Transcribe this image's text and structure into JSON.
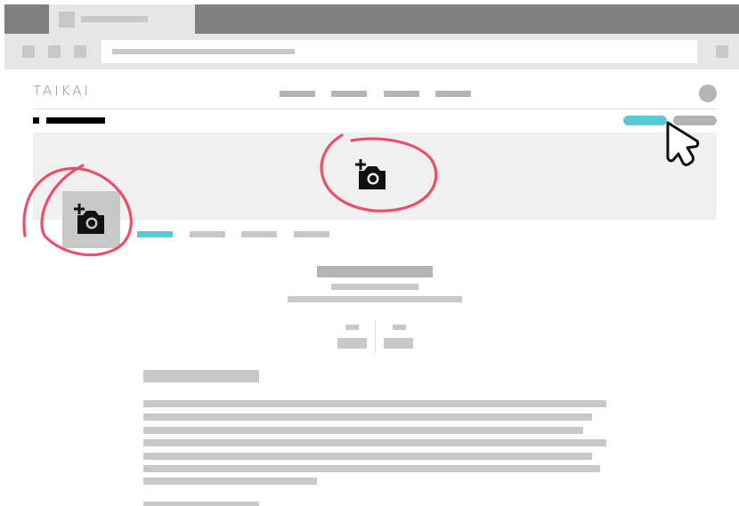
{
  "brand": {
    "logo_text": "TAIKAI"
  },
  "icons": {
    "cover_upload": "add-photo-icon",
    "avatar_upload": "add-photo-icon",
    "cursor": "mouse-pointer-icon"
  },
  "colors": {
    "accent": "#5bc8d6",
    "annotation": "#e8506a",
    "placeholder": "#c8c8c8",
    "chrome_dark": "#808080"
  },
  "profile_tabs": {
    "active_index": 0,
    "count": 4
  },
  "nav": {
    "link_count": 4
  }
}
